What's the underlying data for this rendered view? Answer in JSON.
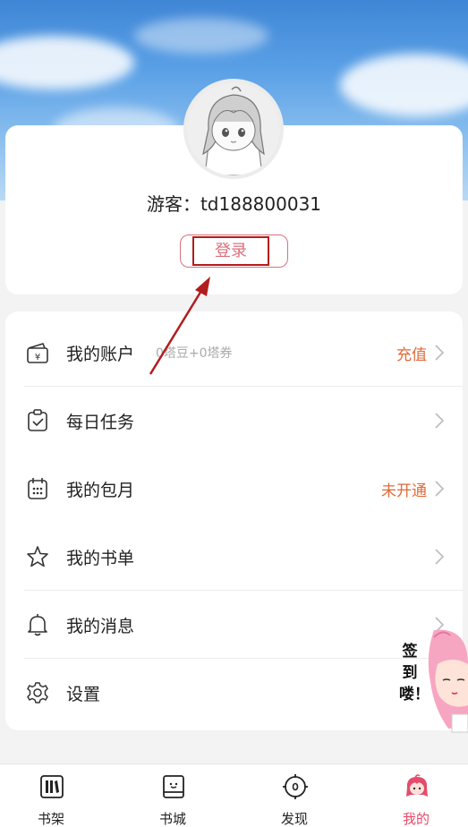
{
  "profile": {
    "username": "游客：td188800031",
    "login_label": "登录"
  },
  "menu": {
    "items": [
      {
        "label": "我的账户",
        "sub": "0塔豆+0塔券",
        "right": "充值",
        "icon": "wallet-icon"
      },
      {
        "label": "每日任务",
        "sub": "",
        "right": "",
        "icon": "clipboard-check-icon"
      },
      {
        "label": "我的包月",
        "sub": "",
        "right": "未开通",
        "icon": "calendar-icon"
      },
      {
        "label": "我的书单",
        "sub": "",
        "right": "",
        "icon": "star-icon"
      },
      {
        "label": "我的消息",
        "sub": "",
        "right": "",
        "icon": "bell-icon"
      },
      {
        "label": "设置",
        "sub": "",
        "right": "",
        "icon": "gear-icon"
      }
    ]
  },
  "mascot": {
    "text": "签到喽！"
  },
  "tabbar": {
    "items": [
      {
        "label": "书架",
        "icon": "bookshelf-icon"
      },
      {
        "label": "书城",
        "icon": "book-store-icon"
      },
      {
        "label": "发现",
        "icon": "compass-icon"
      },
      {
        "label": "我的",
        "icon": "profile-mascot-icon"
      }
    ],
    "active_index": 3
  },
  "colors": {
    "accent": "#e34c6b",
    "orange": "#e06a3a",
    "login_text": "#d9707e",
    "annotation_red": "#b31c1c",
    "sky": "#5aa0e6"
  }
}
